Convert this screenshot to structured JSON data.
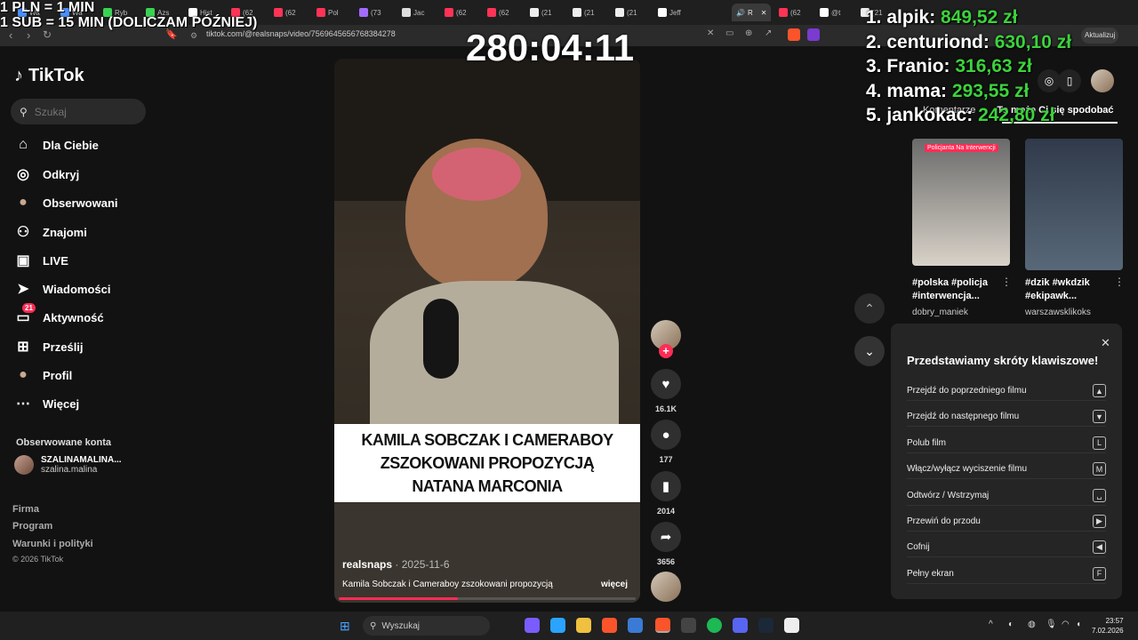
{
  "browser": {
    "tabs": [
      {
        "label": "Wa",
        "color": "#4a8fff"
      },
      {
        "label": "Wa",
        "color": "#4a8fff"
      },
      {
        "label": "Ryb",
        "color": "#39d353"
      },
      {
        "label": "Azs",
        "color": "#39d353"
      },
      {
        "label": "Hist",
        "color": "#ffffff"
      },
      {
        "label": "(62",
        "color": "#ff3355"
      },
      {
        "label": "(62",
        "color": "#ff3355"
      },
      {
        "label": "Pol",
        "color": "#ff3355"
      },
      {
        "label": "(73",
        "color": "#a36bff"
      },
      {
        "label": "Jac",
        "color": "#dddddd"
      },
      {
        "label": "(62",
        "color": "#ff3355"
      },
      {
        "label": "(62",
        "color": "#ff3355"
      },
      {
        "label": "(21",
        "color": "#eeeeee"
      },
      {
        "label": "(21",
        "color": "#eeeeee"
      },
      {
        "label": "(21",
        "color": "#eeeeee"
      },
      {
        "label": "Jeff",
        "color": "#ffffff"
      }
    ],
    "active_tab": {
      "label": "R"
    },
    "more_tabs": [
      {
        "label": "(62",
        "color": "#ff3355"
      },
      {
        "label": "@t",
        "color": "#ffffff"
      },
      {
        "label": "(21",
        "color": "#eeeeee"
      }
    ],
    "url": "tiktok.com/@realsnaps/video/7569645656768384278",
    "update_button": "Aktualizuj"
  },
  "overlay": {
    "line1": "1 PLN = 1 MIN",
    "line2": "1 SUB = 15 MIN (DOLICZAM PÓŹNIEJ)",
    "timer": "280:04:11",
    "leaderboard": [
      {
        "name": "1. alpik:",
        "amount": "849,52 zł"
      },
      {
        "name": "2. centuriond:",
        "amount": "630,10 zł"
      },
      {
        "name": "3. Franio:",
        "amount": "316,63 zł"
      },
      {
        "name": "4. mama:",
        "amount": "293,55 zł"
      },
      {
        "name": "5. jankokac:",
        "amount": "242,80 zł"
      }
    ]
  },
  "sidebar": {
    "logo": "TikTok",
    "search_placeholder": "Szukaj",
    "items": [
      {
        "label": "Dla Ciebie",
        "icon": "home-icon"
      },
      {
        "label": "Odkryj",
        "icon": "compass-icon"
      },
      {
        "label": "Obserwowani",
        "icon": "following-avatar-icon"
      },
      {
        "label": "Znajomi",
        "icon": "friends-icon"
      },
      {
        "label": "LIVE",
        "icon": "live-icon"
      },
      {
        "label": "Wiadomości",
        "icon": "messages-icon"
      },
      {
        "label": "Aktywność",
        "icon": "activity-icon",
        "badge": "21"
      },
      {
        "label": "Prześlij",
        "icon": "upload-icon"
      },
      {
        "label": "Profil",
        "icon": "profile-icon"
      },
      {
        "label": "Więcej",
        "icon": "more-icon"
      }
    ],
    "following_header": "Obserwowane konta",
    "following_account": {
      "display": "SZALINAMALINA...",
      "handle": "szalina.malina"
    },
    "footer": [
      "Firma",
      "Program",
      "Warunki i polityki",
      "© 2026 TikTok"
    ]
  },
  "video": {
    "caption_lines": [
      "KAMILA SOBCZAK I CAMERABOY",
      "ZSZOKOWANI PROPOZYCJĄ",
      "NATANA MARCONIA"
    ],
    "author": "realsnaps",
    "date": " · 2025-11-6",
    "description": "Kamila Sobczak i Cameraboy zszokowani propozycją",
    "more": "więcej",
    "progress_percent": 40
  },
  "actions": {
    "likes": "16.1K",
    "comments": "177",
    "saves": "2014",
    "shares": "3656"
  },
  "right_panel": {
    "tab_comments": "Komentarze",
    "tab_suggested": "To może Ci się spodobać",
    "thumb1_tag": "Policjanta Na Interwencji",
    "videos": [
      {
        "title_line1": "#polska #policja",
        "title_line2": "#interwencja...",
        "user": "dobry_maniek"
      },
      {
        "title_line1": "#dzik #wkdzik",
        "title_line2": "#ekipawk...",
        "user": "warszawsklikoks"
      }
    ]
  },
  "shortcuts": {
    "title": "Przedstawiamy skróty klawiszowe!",
    "rows": [
      {
        "label": "Przejdź do poprzedniego filmu",
        "key": "▲"
      },
      {
        "label": "Przejdź do następnego filmu",
        "key": "▼"
      },
      {
        "label": "Polub film",
        "key": "L"
      },
      {
        "label": "Włącz/wyłącz wyciszenie filmu",
        "key": "M"
      },
      {
        "label": "Odtwórz / Wstrzymaj",
        "key": "␣"
      },
      {
        "label": "Przewiń do przodu",
        "key": "▶"
      },
      {
        "label": "Cofnij",
        "key": "◀"
      },
      {
        "label": "Pełny ekran",
        "key": "F"
      }
    ]
  },
  "taskbar": {
    "search_placeholder": "Wyszukaj",
    "time": "23:57",
    "date": "7.02.2026"
  }
}
